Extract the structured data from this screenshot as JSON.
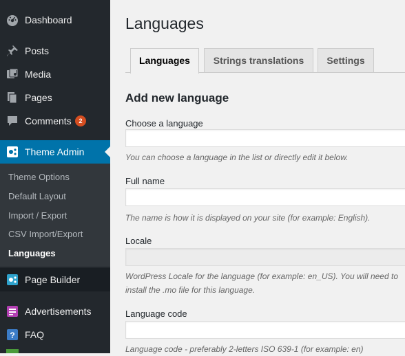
{
  "sidebar": {
    "dashboard": "Dashboard",
    "posts": "Posts",
    "media": "Media",
    "pages": "Pages",
    "comments": "Comments",
    "comments_count": "2",
    "theme_admin": "Theme Admin",
    "submenu": [
      "Theme Options",
      "Default Layout",
      "Import / Export",
      "CSV Import/Export",
      "Languages"
    ],
    "page_builder": "Page Builder",
    "advertisements": "Advertisements",
    "faq": "FAQ"
  },
  "main": {
    "title": "Languages",
    "tabs": [
      {
        "label": "Languages",
        "active": true
      },
      {
        "label": "Strings translations",
        "active": false
      },
      {
        "label": "Settings",
        "active": false
      }
    ],
    "section_title": "Add new language",
    "fields": [
      {
        "label": "Choose a language",
        "value": "",
        "description": "You can choose a language in the list or directly edit it below."
      },
      {
        "label": "Full name",
        "value": "",
        "description": "The name is how it is displayed on your site (for example: English)."
      },
      {
        "label": "Locale",
        "value": "",
        "description": "WordPress Locale for the language (for example: en_US). You will need to install the .mo file for this language."
      },
      {
        "label": "Language code",
        "value": "",
        "description": "Language code - preferably 2-letters ISO 639-1 (for example: en)"
      }
    ]
  },
  "colors": {
    "sidebar_bg": "#23282d",
    "submenu_bg": "#32373c",
    "accent": "#0073aa",
    "badge": "#d54e21"
  }
}
